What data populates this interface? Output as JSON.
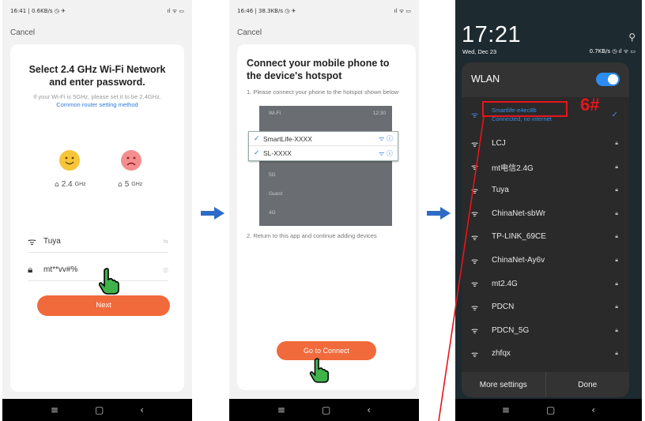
{
  "phone1": {
    "status_left": "16:41 | 0.6KB/s ◷ ✈",
    "status_right": "ıl ᯤ ▭",
    "cancel": "Cancel",
    "title": "Select 2.4 GHz Wi-Fi Network and enter password.",
    "subtitle": "If your Wi-Fi is 5GHz, please set it to be 2.4GHz.",
    "subtitle_link": "Common router setting method",
    "band_24_value": "2.4",
    "band_24_unit": "GHz",
    "band_5_value": "5",
    "band_5_unit": "GHz",
    "wifi_name": "Tuya",
    "password": "mt**vv#%",
    "next_button": "Next"
  },
  "phone2": {
    "status_left": "16:46 | 38.3KB/s ◷ ✈",
    "status_right": "ıl ᯤ ▭",
    "cancel": "Cancel",
    "title": "Connect your mobile phone to the device's hotspot",
    "step1": "1. Please connect your phone to the hotspot shown below",
    "mock_header": "Wi-Fi",
    "mock_clock": "12:30",
    "popup_items": [
      "SmartLife-XXXX",
      "SL-XXXX"
    ],
    "mock_rows": [
      "5G",
      "Guest",
      "4G"
    ],
    "step2": "2. Return to this app and continue adding devices",
    "connect_button": "Go to Connect"
  },
  "phone3": {
    "time": "17:21",
    "date": "Wed, Dec 23",
    "status_right": "0.7KB/s ◷ ıl ᯤ ▭",
    "wlan_title": "WLAN",
    "connected_network": "Smartlife-e4ec8b",
    "connected_status": "Connected, no internet",
    "annotation": "6#",
    "networks": [
      "LCJ",
      "mt电信2.4G",
      "Tuya",
      "ChinaNet-sbWr",
      "TP-LINK_69CE",
      "ChinaNet-Ay6v",
      "mt2.4G",
      "PDCN",
      "PDCN_5G",
      "zhfqx"
    ],
    "more_settings": "More settings",
    "done": "Done"
  },
  "colors": {
    "accent_orange": "#f16a3b",
    "link_blue": "#2f7ad8",
    "toggle_blue": "#2d8cf0",
    "annotation_red": "#e8141c",
    "arrow_blue": "#2e6bc7"
  },
  "icons": [
    "wifi-icon",
    "lock-icon",
    "eye-icon",
    "hand-pointer-icon",
    "smile-face-icon",
    "sad-face-icon",
    "router-icon",
    "check-icon",
    "info-icon",
    "search-icon",
    "arrow-right-icon"
  ]
}
